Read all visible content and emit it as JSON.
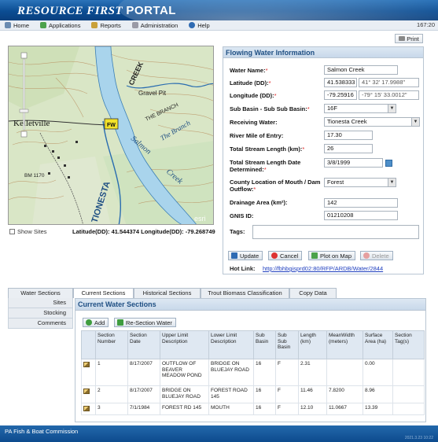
{
  "app": {
    "brand_main": "RESOURCE FIRST",
    "brand_portal": "PORTAL",
    "clock": "167:20",
    "footer": "PA Fish & Boat Commission",
    "version": "2021.3.23 10:22"
  },
  "menu": [
    {
      "label": "Home",
      "icon": "home-icon",
      "color": "#6a8bb0"
    },
    {
      "label": "Applications",
      "icon": "applications-icon",
      "color": "#4ca24c"
    },
    {
      "label": "Reports",
      "icon": "reports-icon",
      "color": "#c9a13a"
    },
    {
      "label": "Administration",
      "icon": "administration-icon",
      "color": "#9a9aa6"
    },
    {
      "label": "Help",
      "icon": "help-icon",
      "color": "#2f6bb3"
    }
  ],
  "print_label": "Print",
  "map": {
    "labels": [
      "CREEK",
      "Kelletville",
      "Gravel Pit",
      "THE BRANCH",
      "The Branch",
      "Salmon",
      "Creek",
      "TIONESTA",
      "BM 1170"
    ],
    "marker": "FW",
    "watermark": "esri",
    "show_sites": "Show Sites",
    "coords": "Latitude(DD): 41.544374 Longitude(DD): -79.268749"
  },
  "form": {
    "title": "Flowing Water Information",
    "water_name_label": "Water Name:",
    "water_name": "Salmon Creek",
    "latitude_label": "Latitude (DD):",
    "latitude": "41.538333",
    "latitude_dms": "41° 32' 17.9988\"",
    "longitude_label": "Longitude (DD):",
    "longitude": "-79.25916",
    "longitude_dms": "-79° 15' 33.0012\"",
    "sub_basin_label": "Sub Basin - Sub Sub Basin:",
    "sub_basin": "16F",
    "receiving_water_label": "Receiving Water:",
    "receiving_water": "Tionesta Creek",
    "river_mile_label": "River Mile of Entry:",
    "river_mile": "17.30",
    "total_length_label": "Total Stream Length (km):",
    "total_length": "26",
    "length_date_label": "Total Stream Length Date Determined:",
    "length_date": "3/8/1999",
    "county_label": "County Location of Mouth / Dam Outflow:",
    "county": "Forest",
    "drainage_label": "Drainage Area (km²):",
    "drainage": "142",
    "gnis_label": "GNIS ID:",
    "gnis": "01210208",
    "tags_label": "Tags:",
    "update": "Update",
    "cancel": "Cancel",
    "plot": "Plot on Map",
    "delete": "Delete",
    "hot_link_label": "Hot Link:",
    "hot_link": "http://fbhbgisprd02:80/RFP/ARDB/Water/2844"
  },
  "tabs": [
    "Water Sections",
    "Current Sections",
    "Historical Sections",
    "Trout Biomass Classification",
    "Copy Data"
  ],
  "left_nav": [
    "Sites",
    "Stocking",
    "Comments"
  ],
  "sections": {
    "title": "Current Water Sections",
    "add": "Add",
    "resection": "Re-Section Water",
    "columns": [
      "Section Number",
      "Section Date",
      "Upper Limit Description",
      "Lower Limit Description",
      "Sub Basin",
      "Sub Sub Basin",
      "Length (km)",
      "MeanWidth (meters)",
      "Surface Area (ha)",
      "Section Tag(s)"
    ],
    "rows": [
      {
        "number": "1",
        "date": "8/17/2007",
        "upper": "OUTFLOW OF BEAVER MEADOW POND",
        "lower": "BRIDGE ON BLUEJAY ROAD",
        "sub_basin": "16",
        "sub_sub_basin": "F",
        "length": "2.31",
        "mean_width": "",
        "surface_area": "0.00",
        "tags": ""
      },
      {
        "number": "2",
        "date": "8/17/2007",
        "upper": "BRIDGE ON BLUEJAY ROAD",
        "lower": "FOREST ROAD 145",
        "sub_basin": "16",
        "sub_sub_basin": "F",
        "length": "11.46",
        "mean_width": "7.8200",
        "surface_area": "8.96",
        "tags": ""
      },
      {
        "number": "3",
        "date": "7/1/1984",
        "upper": "FOREST RD 145",
        "lower": "MOUTH",
        "sub_basin": "16",
        "sub_sub_basin": "F",
        "length": "12.10",
        "mean_width": "11.0667",
        "surface_area": "13.39",
        "tags": ""
      }
    ]
  }
}
